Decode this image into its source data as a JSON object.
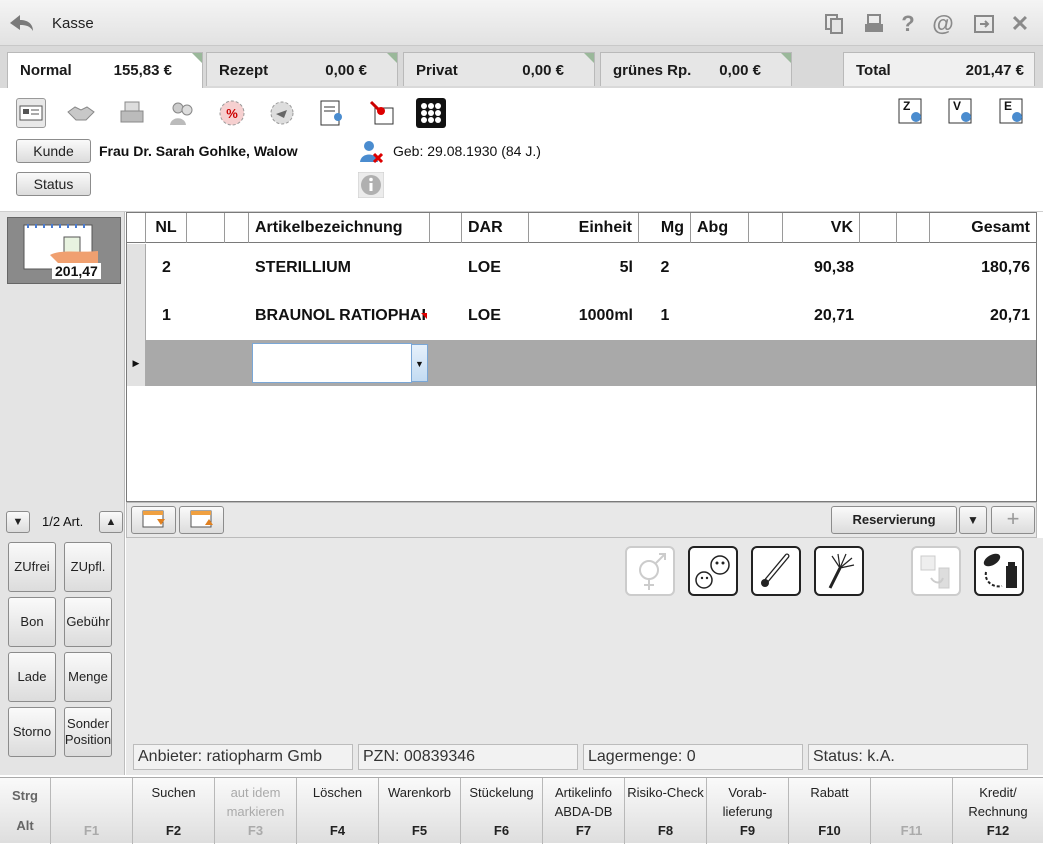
{
  "window": {
    "title": "Kasse"
  },
  "tabs": [
    {
      "label": "Normal",
      "amount": "155,83 €",
      "active": true
    },
    {
      "label": "Rezept",
      "amount": "0,00 €",
      "active": false
    },
    {
      "label": "Privat",
      "amount": "0,00 €",
      "active": false
    },
    {
      "label": "grünes Rp.",
      "amount": "0,00 €",
      "active": false
    }
  ],
  "total": {
    "label": "Total",
    "amount": "201,47 €"
  },
  "customer": {
    "kunde_button": "Kunde",
    "status_button": "Status",
    "name": "Frau Dr. Sarah Gohlke, Walow",
    "birth": "Geb: 29.08.1930 (84 J.)",
    "zve": [
      "Z",
      "V",
      "E"
    ]
  },
  "receipt": {
    "total": "201,47",
    "counter": "1/2 Art."
  },
  "grid": {
    "headers": [
      "NL",
      "",
      "",
      "Artikelbezeichnung",
      "",
      "DAR",
      "Einheit",
      "Mg",
      "Abg",
      "",
      "VK",
      "",
      "",
      "Gesamt"
    ],
    "rows": [
      {
        "nl": "2",
        "name": "STERILLIUM",
        "dar": "LOE",
        "einheit": "5l",
        "mg": "2",
        "abg": "",
        "vk": "90,38",
        "gesamt": "180,76"
      },
      {
        "nl": "1",
        "name": "BRAUNOL RATIOPHARM",
        "dar": "LOE",
        "einheit": "1000ml",
        "mg": "1",
        "abg": "",
        "vk": "20,71",
        "gesamt": "20,71"
      }
    ],
    "new_row_value": ""
  },
  "footer": {
    "reservierung": "Reservierung"
  },
  "function_buttons": [
    [
      "ZUfrei",
      "ZUpfl."
    ],
    [
      "Bon",
      "Gebühr"
    ],
    [
      "Lade",
      "Menge"
    ],
    [
      "Storno",
      "Sonder Position"
    ]
  ],
  "info": {
    "anbieter": "Anbieter: ratiopharm Gmb",
    "pzn": "PZN: 00839346",
    "lagermenge": "Lagermenge: 0",
    "status": "Status: k.A."
  },
  "fkeys": [
    {
      "label": "",
      "key": "F1",
      "disabled": true
    },
    {
      "label": "Suchen",
      "key": "F2",
      "disabled": false
    },
    {
      "label": "aut idem markieren",
      "key": "F3",
      "disabled": true
    },
    {
      "label": "Löschen",
      "key": "F4",
      "disabled": false
    },
    {
      "label": "Warenkorb",
      "key": "F5",
      "disabled": false
    },
    {
      "label": "Stückelung",
      "key": "F6",
      "disabled": false
    },
    {
      "label": "Artikelinfo ABDA-DB",
      "key": "F7",
      "disabled": false
    },
    {
      "label": "Risiko-Check",
      "key": "F8",
      "disabled": false
    },
    {
      "label": "Vorab-lieferung",
      "key": "F9",
      "disabled": false
    },
    {
      "label": "Rabatt",
      "key": "F10",
      "disabled": false
    },
    {
      "label": "",
      "key": "F11",
      "disabled": true
    },
    {
      "label": "Kredit/ Rechnung",
      "key": "F12",
      "disabled": false
    }
  ],
  "modifiers": {
    "strg": "Strg",
    "alt": "Alt"
  }
}
